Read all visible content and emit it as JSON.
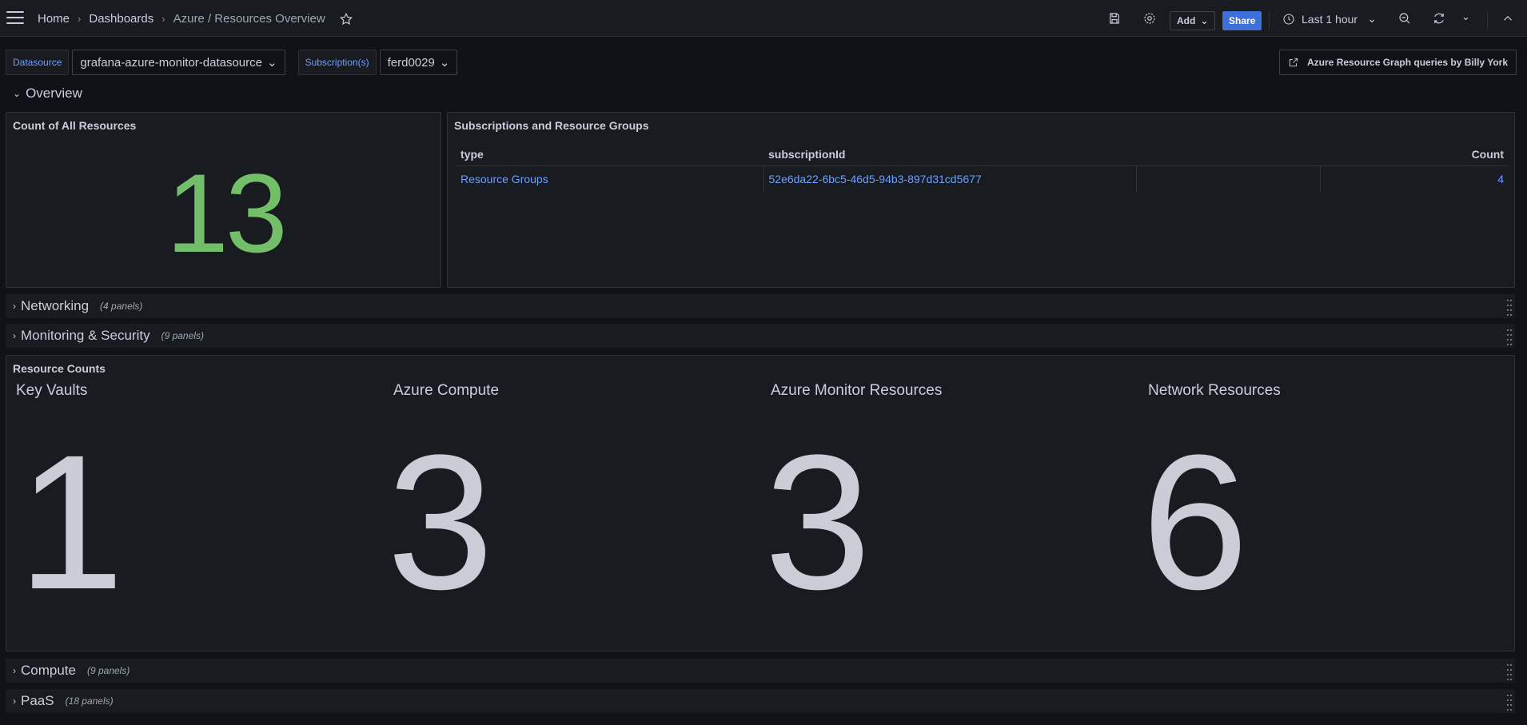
{
  "topbar": {
    "breadcrumb": [
      "Home",
      "Dashboards",
      "Azure / Resources Overview"
    ],
    "add_label": "Add",
    "share_label": "Share",
    "time_range": "Last 1 hour"
  },
  "variables": [
    {
      "label": "Datasource",
      "value": "grafana-azure-monitor-datasource"
    },
    {
      "label": "Subscription(s)",
      "value": "ferd0029"
    }
  ],
  "dashboard_link": "Azure Resource Graph queries by Billy York",
  "rows": {
    "overview": {
      "title": "Overview"
    },
    "networking": {
      "title": "Networking",
      "count": "(4 panels)"
    },
    "monitoring": {
      "title": "Monitoring & Security",
      "count": "(9 panels)"
    },
    "compute": {
      "title": "Compute",
      "count": "(9 panels)"
    },
    "paas": {
      "title": "PaaS",
      "count": "(18 panels)"
    }
  },
  "panels": {
    "count_all": {
      "title": "Count of All Resources",
      "value": "13",
      "color": "#73bf69"
    },
    "subscriptions": {
      "title": "Subscriptions and Resource Groups",
      "columns": [
        "type",
        "subscriptionId",
        "",
        "Count"
      ],
      "rows": [
        [
          "Resource Groups",
          "52e6da22-6bc5-46d5-94b3-897d31cd5677",
          "",
          "4"
        ]
      ]
    },
    "resource_counts": {
      "title": "Resource Counts",
      "stats": [
        {
          "label": "Key Vaults",
          "value": "1"
        },
        {
          "label": "Azure Compute",
          "value": "3"
        },
        {
          "label": "Azure Monitor Resources",
          "value": "3"
        },
        {
          "label": "Network Resources",
          "value": "6"
        }
      ]
    }
  },
  "colors": {
    "accent": "#3d71d9",
    "link": "#6e9fff",
    "stat_green": "#73bf69",
    "background": "#111217",
    "panel": "#181b1f"
  }
}
